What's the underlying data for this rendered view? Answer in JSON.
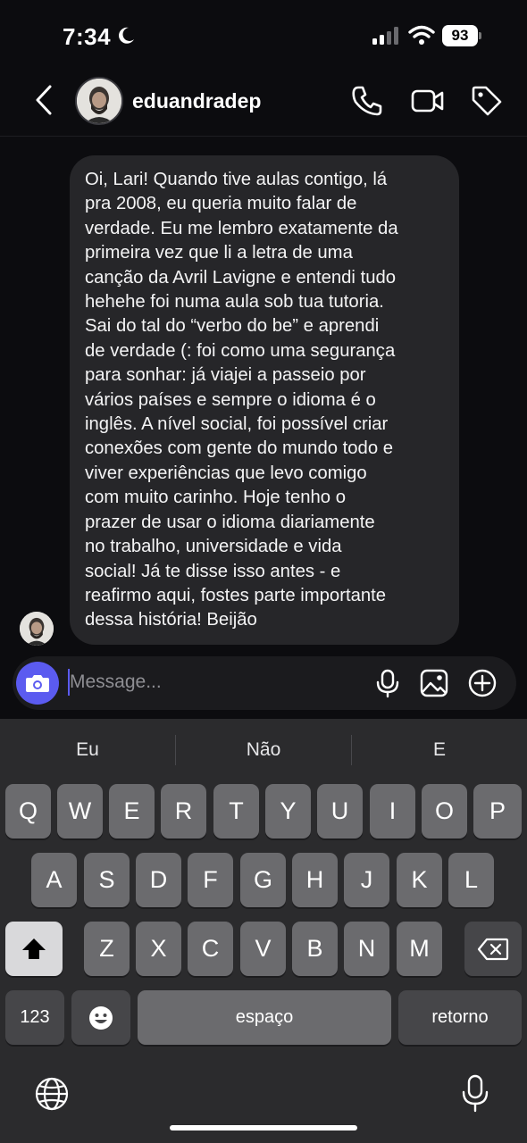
{
  "status_bar": {
    "time": "7:34",
    "battery": "93",
    "icons": [
      "moon-icon",
      "signal-icon",
      "wifi-icon",
      "battery-icon"
    ]
  },
  "header": {
    "username": "eduandradep",
    "icons": [
      "back-chevron-icon",
      "phone-icon",
      "video-camera-icon",
      "tag-icon"
    ]
  },
  "message": {
    "text": "Oi, Lari! Quando tive aulas contigo, lá\npra 2008, eu queria muito falar de\nverdade. Eu me lembro exatamente da\nprimeira vez que li a letra de uma\ncanção da Avril Lavigne e entendi tudo\nhehehe foi numa aula sob tua tutoria.\nSai do tal do “verbo do be” e aprendi\nde verdade (: foi como uma segurança\npara sonhar: já viajei a passeio por\nvários países e sempre o idioma é o\ninglês. A nível social, foi possível criar\nconexões com gente do mundo todo e\nviver experiências que levo comigo\ncom muito carinho. Hoje tenho o\nprazer de usar o idioma diariamente\nno trabalho, universidade e vida\nsocial! Já te disse isso antes - e\nreafirmo aqui, fostes parte importante\ndessa história! Beijão"
  },
  "composer": {
    "placeholder": "Message...",
    "icons": [
      "camera-icon",
      "microphone-icon",
      "image-icon",
      "plus-circle-icon"
    ]
  },
  "keyboard": {
    "suggestions": [
      "Eu",
      "Não",
      "E"
    ],
    "row1": [
      "Q",
      "W",
      "E",
      "R",
      "T",
      "Y",
      "U",
      "I",
      "O",
      "P"
    ],
    "row2": [
      "A",
      "S",
      "D",
      "F",
      "G",
      "H",
      "J",
      "K",
      "L"
    ],
    "row3": [
      "Z",
      "X",
      "C",
      "V",
      "B",
      "N",
      "M"
    ],
    "numbers_key": "123",
    "space_key": "espaço",
    "return_key": "retorno",
    "icons": [
      "shift-icon",
      "backspace-icon",
      "emoji-icon",
      "globe-icon",
      "microphone-icon"
    ]
  },
  "colors": {
    "background": "#0c0c0f",
    "bubble": "#262629",
    "accent": "#5b5bf0",
    "keyboard": "#2b2b2d",
    "key": "#6b6b6e"
  }
}
